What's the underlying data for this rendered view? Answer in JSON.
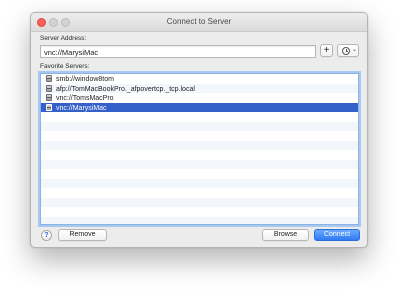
{
  "window": {
    "title": "Connect to Server"
  },
  "address": {
    "label": "Server Address:",
    "value": "vnc://MarysiMac"
  },
  "buttons": {
    "add": "+",
    "help": "?",
    "remove": "Remove",
    "browse": "Browse",
    "connect": "Connect",
    "recent_icon": "clock-icon",
    "recent_chevron": "⌄"
  },
  "favorites": {
    "label": "Favorite Servers:",
    "items": [
      "smb://window8tom",
      "afp://TomMacBookPro._afpovertcp._tcp.local",
      "vnc://TomsMacPro",
      "vnc://MarysiMac"
    ],
    "selected_index": 3
  },
  "colors": {
    "selection": "#3360c9",
    "accent": "#2f7bf2",
    "close": "#fc5f57"
  }
}
